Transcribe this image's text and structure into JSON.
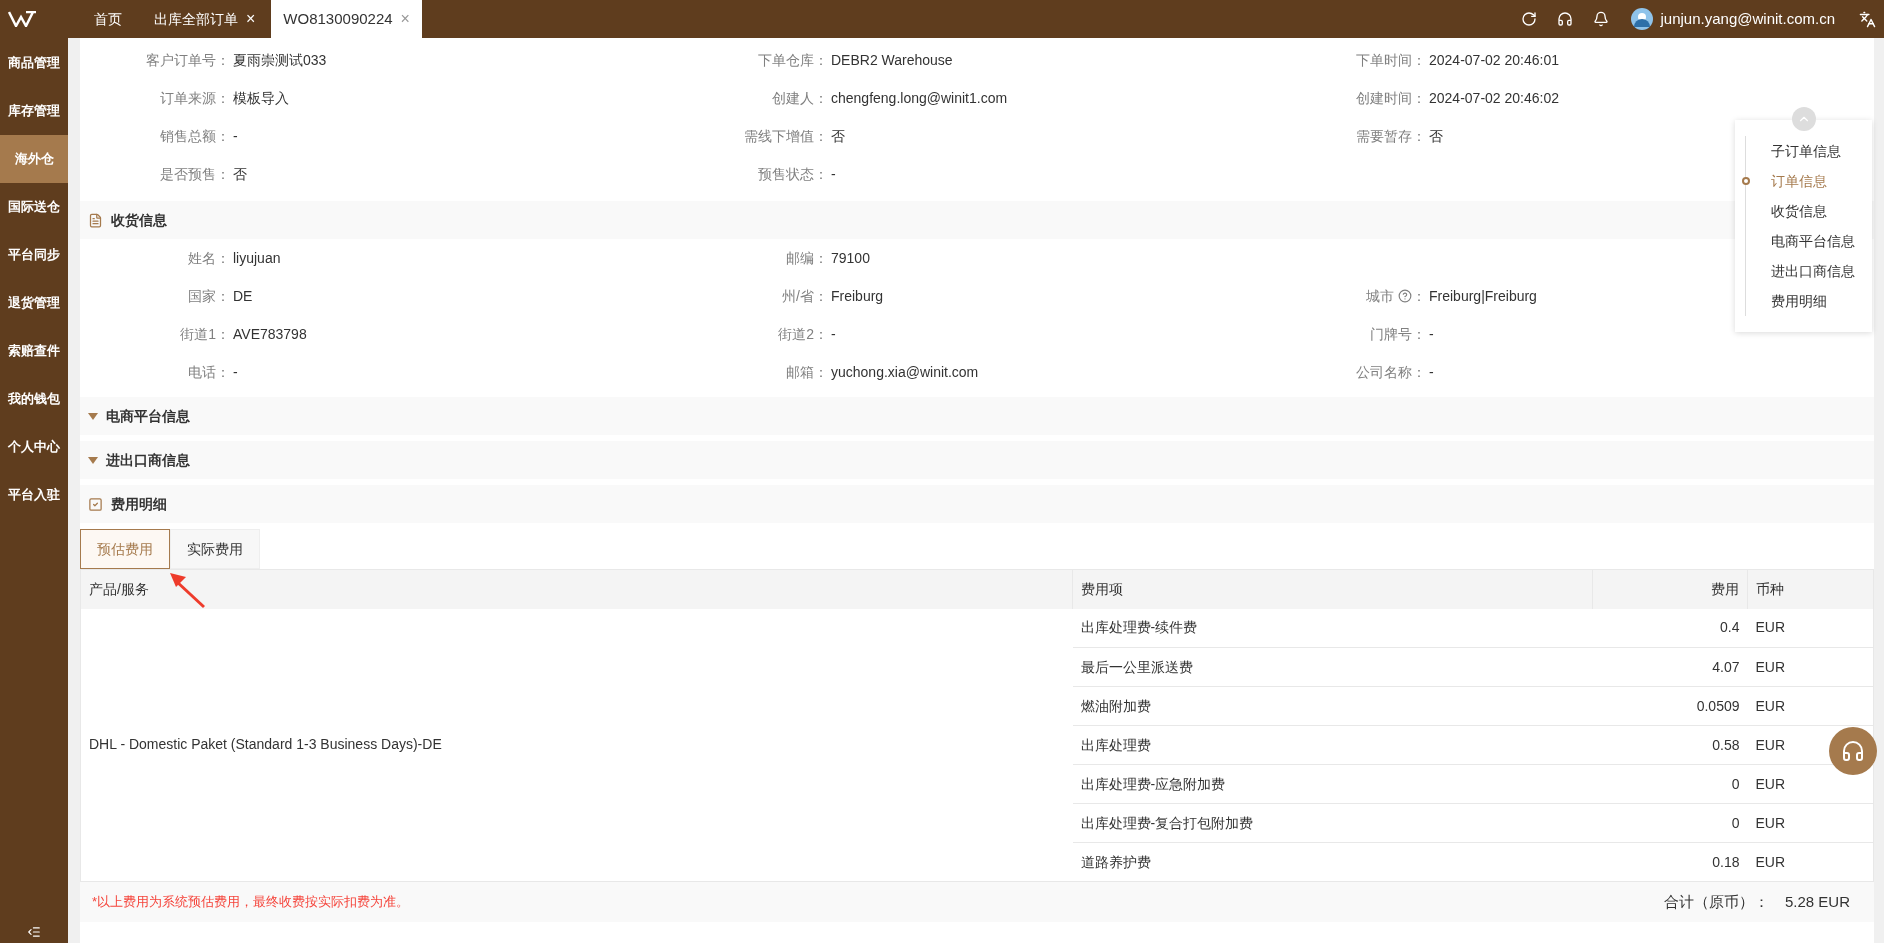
{
  "top_tabs": [
    {
      "label": "首页",
      "selected": false,
      "closable": false
    },
    {
      "label": "出库全部订单",
      "selected": false,
      "closable": true
    },
    {
      "label": "WO8130090224",
      "selected": true,
      "closable": true
    }
  ],
  "close_mark": "×",
  "user": {
    "email": "junjun.yang@winit.com.cn"
  },
  "sidebar": {
    "items": [
      {
        "label": "商品管理",
        "selected": false
      },
      {
        "label": "库存管理",
        "selected": false
      },
      {
        "label": "海外仓",
        "selected": true
      },
      {
        "label": "国际送仓",
        "selected": false
      },
      {
        "label": "平台同步",
        "selected": false
      },
      {
        "label": "退货管理",
        "selected": false
      },
      {
        "label": "索赔查件",
        "selected": false
      },
      {
        "label": "我的钱包",
        "selected": false
      },
      {
        "label": "个人中心",
        "selected": false
      },
      {
        "label": "平台入驻",
        "selected": false
      }
    ]
  },
  "order_info": {
    "rows": [
      [
        {
          "label": "客户订单号：",
          "value": "夏雨崇测试033",
          "help": false
        },
        {
          "label": "下单仓库：",
          "value": "DEBR2 Warehouse",
          "help": false
        },
        {
          "label": "下单时间：",
          "value": "2024-07-02 20:46:01",
          "help": false
        }
      ],
      [
        {
          "label": "订单来源：",
          "value": "模板导入",
          "help": false
        },
        {
          "label": "创建人：",
          "value": "chengfeng.long@winit1.com",
          "help": false
        },
        {
          "label": "创建时间：",
          "value": "2024-07-02 20:46:02",
          "help": false
        }
      ],
      [
        {
          "label": "销售总额：",
          "value": "-",
          "help": false
        },
        {
          "label": "需线下增值：",
          "value": "否",
          "help": false
        },
        {
          "label": "需要暂存：",
          "value": "否",
          "help": false
        }
      ],
      [
        {
          "label": "是否预售：",
          "value": "否",
          "help": false
        },
        {
          "label": "预售状态：",
          "value": "-",
          "help": false
        }
      ]
    ]
  },
  "sections": [
    {
      "kind": "document",
      "title": "收货信息",
      "rows": [
        [
          {
            "label": "姓名：",
            "value": "liyujuan",
            "help": false
          },
          {
            "label": "邮编：",
            "value": "79100",
            "help": false
          }
        ],
        [
          {
            "label": "国家：",
            "value": "DE",
            "help": false
          },
          {
            "label": "州/省：",
            "value": "Freiburg",
            "help": false
          },
          {
            "label": "城市",
            "value": "Freiburg|Freiburg",
            "help": true,
            "label_suffix": "："
          }
        ],
        [
          {
            "label": "街道1：",
            "value": "AVE783798",
            "help": false
          },
          {
            "label": "街道2：",
            "value": "-",
            "help": false
          },
          {
            "label": "门牌号：",
            "value": "-",
            "help": false
          }
        ],
        [
          {
            "label": "电话：",
            "value": "-",
            "help": false
          },
          {
            "label": "邮箱：",
            "value": "yuchong.xia@winit.com",
            "help": false
          },
          {
            "label": "公司名称：",
            "value": "-",
            "help": false
          }
        ]
      ]
    },
    {
      "kind": "collapsible",
      "title": "电商平台信息"
    },
    {
      "kind": "collapsible",
      "title": "进出口商信息"
    },
    {
      "kind": "checklist",
      "title": "费用明细",
      "tabs": [
        {
          "label": "预估费用",
          "selected": true
        },
        {
          "label": "实际费用",
          "selected": false
        }
      ],
      "table": {
        "columns": [
          "产品/服务",
          "费用项",
          "费用",
          "币种"
        ],
        "product": "DHL - Domestic Paket (Standard 1-3 Business Days)-DE",
        "rows": [
          {
            "item": "出库处理费-续件费",
            "fee": "0.4",
            "currency": "EUR"
          },
          {
            "item": "最后一公里派送费",
            "fee": "4.07",
            "currency": "EUR"
          },
          {
            "item": "燃油附加费",
            "fee": "0.0509",
            "currency": "EUR"
          },
          {
            "item": "出库处理费",
            "fee": "0.58",
            "currency": "EUR"
          },
          {
            "item": "出库处理费-应急附加费",
            "fee": "0",
            "currency": "EUR"
          },
          {
            "item": "出库处理费-复合打包附加费",
            "fee": "0",
            "currency": "EUR"
          },
          {
            "item": "道路养护费",
            "fee": "0.18",
            "currency": "EUR"
          }
        ]
      },
      "note": "*以上费用为系统预估费用，最终收费按实际扣费为准。",
      "total_label": "合计（原币）：",
      "total_value": "5.28 EUR"
    }
  ],
  "anchor_nav": {
    "items": [
      {
        "label": "子订单信息",
        "selected": false
      },
      {
        "label": "订单信息",
        "selected": true
      },
      {
        "label": "收货信息",
        "selected": false
      },
      {
        "label": "电商平台信息",
        "selected": false
      },
      {
        "label": "进出口商信息",
        "selected": false
      },
      {
        "label": "费用明细",
        "selected": false
      }
    ]
  }
}
